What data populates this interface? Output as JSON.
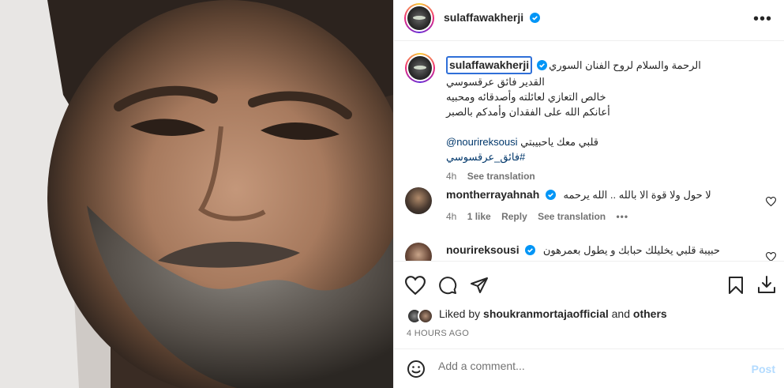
{
  "post_author": {
    "username": "sulaffawakherji",
    "verified": true
  },
  "caption": {
    "username": "sulaffawakherji",
    "lines": [
      "الرحمة والسلام لروح الفنان السوري",
      "القدير فائق عرقسوسي",
      "خالص التعازي لعائلته وأصدقائه ومحبيه",
      "أعانكم الله على الفقدان وأمدكم بالصبر"
    ],
    "mention_text": "قلبي معك ياحبيبتي",
    "mention": "@nourireksousi",
    "hashtag": "#فائق_عرقسوسي",
    "time": "4h",
    "see_translation": "See translation"
  },
  "comments": [
    {
      "username": "montherrayahnah",
      "verified": true,
      "text": "لا حول ولا قوة الا بالله .. الله يرحمه",
      "time": "4h",
      "likes": "1 like",
      "reply": "Reply",
      "see_translation": "See translation",
      "more": "•••"
    },
    {
      "username": "nourireksousi",
      "verified": true,
      "text": "حبيبة قلبي يخليلك حبابك و يطول بعمرهون"
    }
  ],
  "likes": {
    "prefix": "Liked by",
    "user": "shoukranmortajaofficial",
    "joiner": "and",
    "others": "others"
  },
  "timestamp": "4 HOURS AGO",
  "comment_box": {
    "placeholder": "Add a comment...",
    "post_label": "Post"
  },
  "colors": {
    "verified": "#0095f6",
    "link": "#00376b",
    "post_disabled": "#b3dbff"
  }
}
